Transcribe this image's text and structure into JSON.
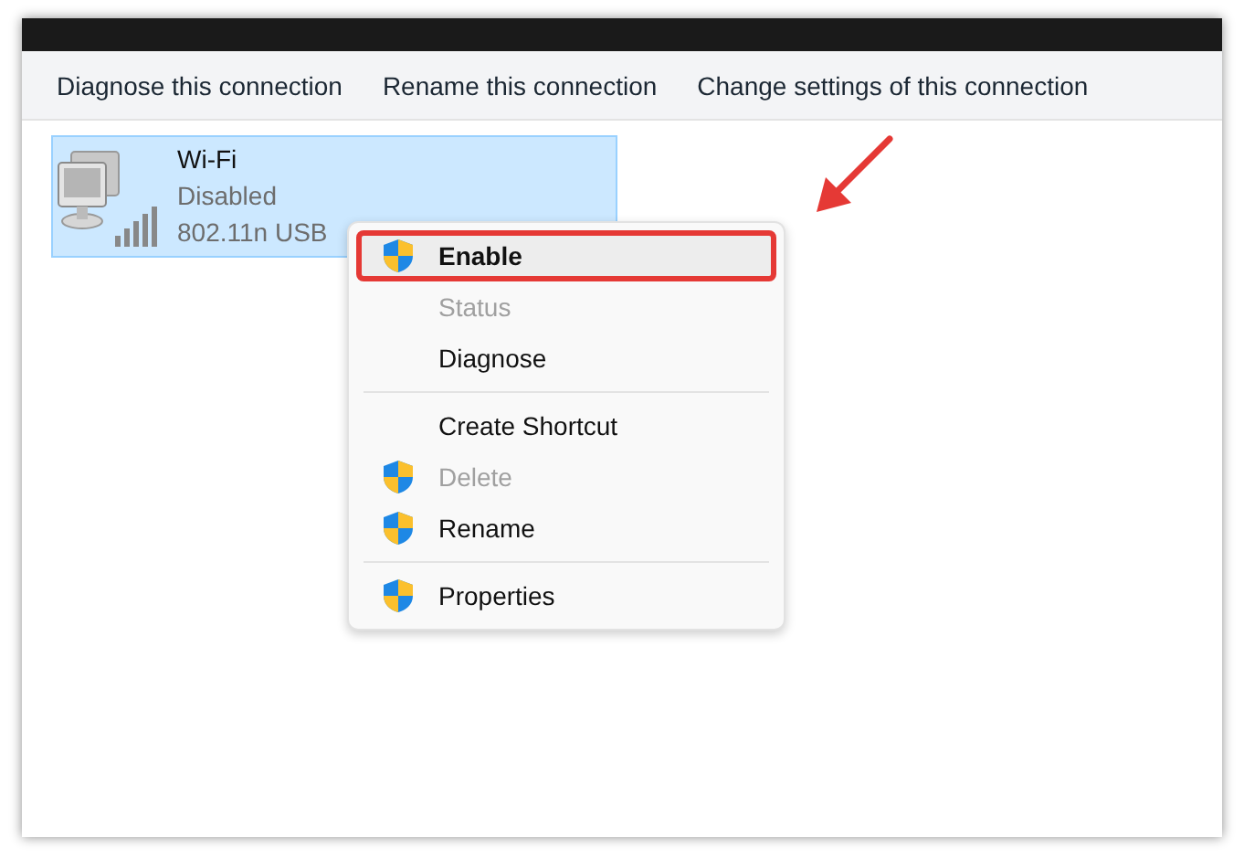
{
  "toolbar": [
    {
      "label": "Diagnose this connection"
    },
    {
      "label": "Rename this connection"
    },
    {
      "label": "Change settings of this connection"
    }
  ],
  "adapter": {
    "name": "Wi-Fi",
    "status": "Disabled",
    "device": "802.11n USB",
    "selected": true
  },
  "context_menu": [
    {
      "kind": "item",
      "label": "Enable",
      "shield": true,
      "disabled": false,
      "default": true,
      "highlighted": true
    },
    {
      "kind": "item",
      "label": "Status",
      "shield": false,
      "disabled": true,
      "default": false,
      "highlighted": false
    },
    {
      "kind": "item",
      "label": "Diagnose",
      "shield": false,
      "disabled": false,
      "default": false,
      "highlighted": false
    },
    {
      "kind": "separator"
    },
    {
      "kind": "item",
      "label": "Create Shortcut",
      "shield": false,
      "disabled": false,
      "default": false,
      "highlighted": false
    },
    {
      "kind": "item",
      "label": "Delete",
      "shield": true,
      "disabled": true,
      "default": false,
      "highlighted": false
    },
    {
      "kind": "item",
      "label": "Rename",
      "shield": true,
      "disabled": false,
      "default": false,
      "highlighted": false
    },
    {
      "kind": "separator"
    },
    {
      "kind": "item",
      "label": "Properties",
      "shield": true,
      "disabled": false,
      "default": false,
      "highlighted": false
    }
  ]
}
